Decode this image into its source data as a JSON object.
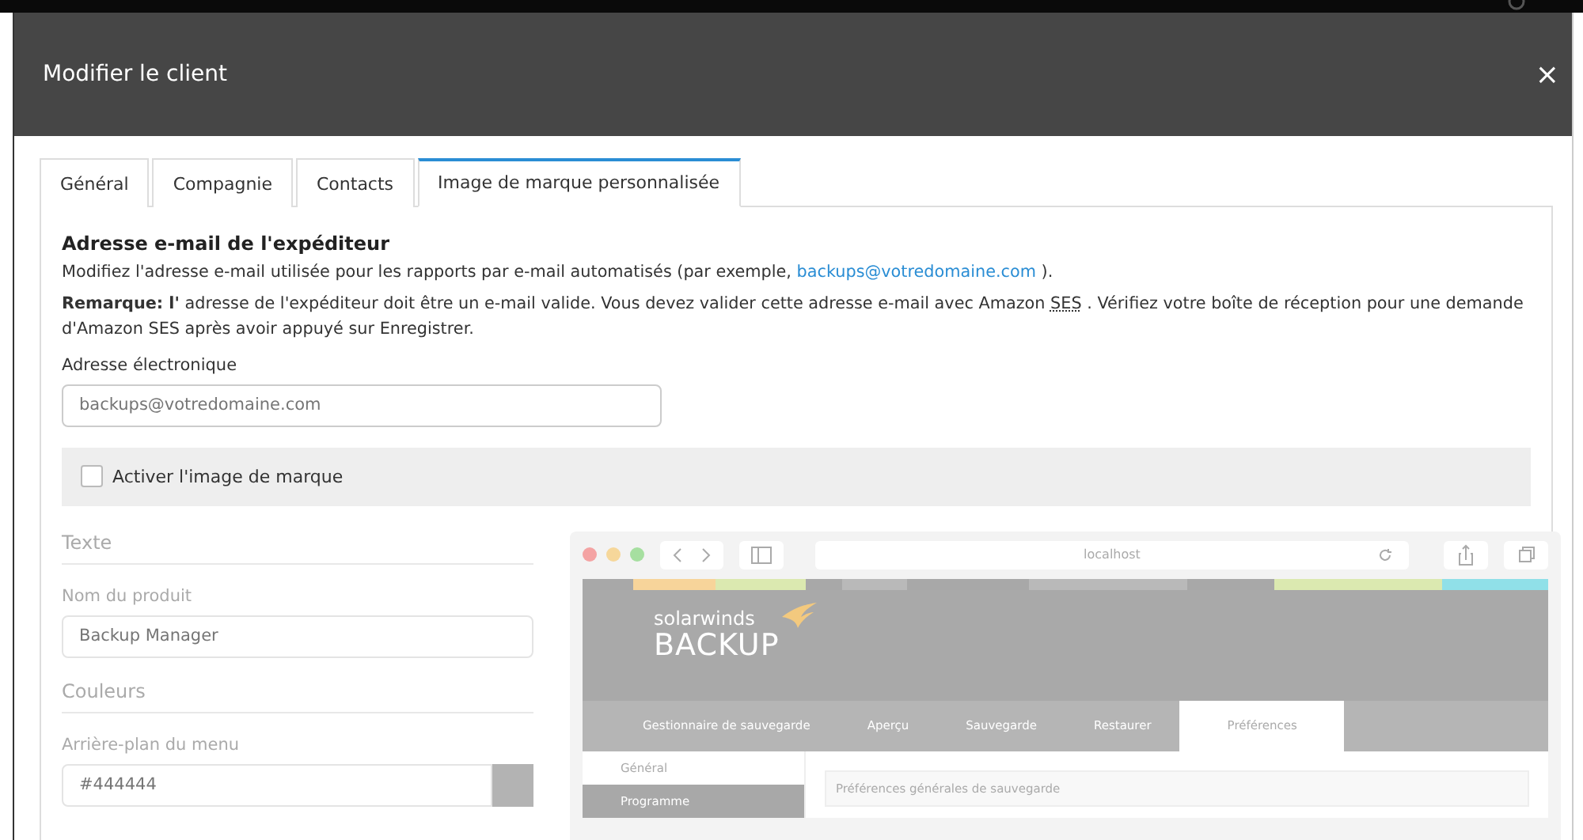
{
  "dialog": {
    "title": "Modifier le client",
    "close": "×"
  },
  "tabs": [
    {
      "label": "Général",
      "selected": false
    },
    {
      "label": "Compagnie",
      "selected": false
    },
    {
      "label": "Contacts",
      "selected": false
    },
    {
      "label": "Image de marque personnalisée",
      "selected": true
    }
  ],
  "sender": {
    "heading": "Adresse e-mail de l'expéditeur",
    "line_1": "Modifiez l'adresse e-mail utilisée pour les rapports par e-mail automatisés (par exemple,",
    "link": "backups@votredomaine.com",
    "line_1_end": ").",
    "note": "**Remarque: l'** adresse de l'expéditeur doit être un e-mail valide. Vous devez valider cette adresse e-mail avec Amazon",
    "abbr": "SES",
    "note_end": ". Vérifiez votre boîte de réception pour une demande d'Amazon SES après avoir appuyé sur Enregistrer.",
    "field_label": "Adresse électronique",
    "placeholder": "backups@votredomaine.com"
  },
  "branding_toggle": {
    "label": "Activer l'image de marque",
    "checked": false
  },
  "text_section": {
    "heading": "Texte",
    "field_label": "Nom du produit",
    "placeholder": "Backup Manager"
  },
  "colors_section": {
    "heading": "Couleurs",
    "field_label": "Arrière-plan du menu",
    "placeholder": "#444444"
  },
  "preview": {
    "url": "localhost",
    "logo_top": "solarwinds",
    "logo_bottom": "BACKUP",
    "nav": [
      {
        "label": "Gestionnaire de sauvegarde",
        "selected": false
      },
      {
        "label": "Aperçu",
        "selected": false
      },
      {
        "label": "Sauvegarde",
        "selected": false
      },
      {
        "label": "Restaurer",
        "selected": false
      },
      {
        "label": "Préférences",
        "selected": true
      }
    ],
    "sidebar": [
      {
        "label": "Général",
        "selected": true
      },
      {
        "label": "Programme",
        "selected": false
      }
    ],
    "panel_title": "Préférences générales de sauvegarde"
  }
}
